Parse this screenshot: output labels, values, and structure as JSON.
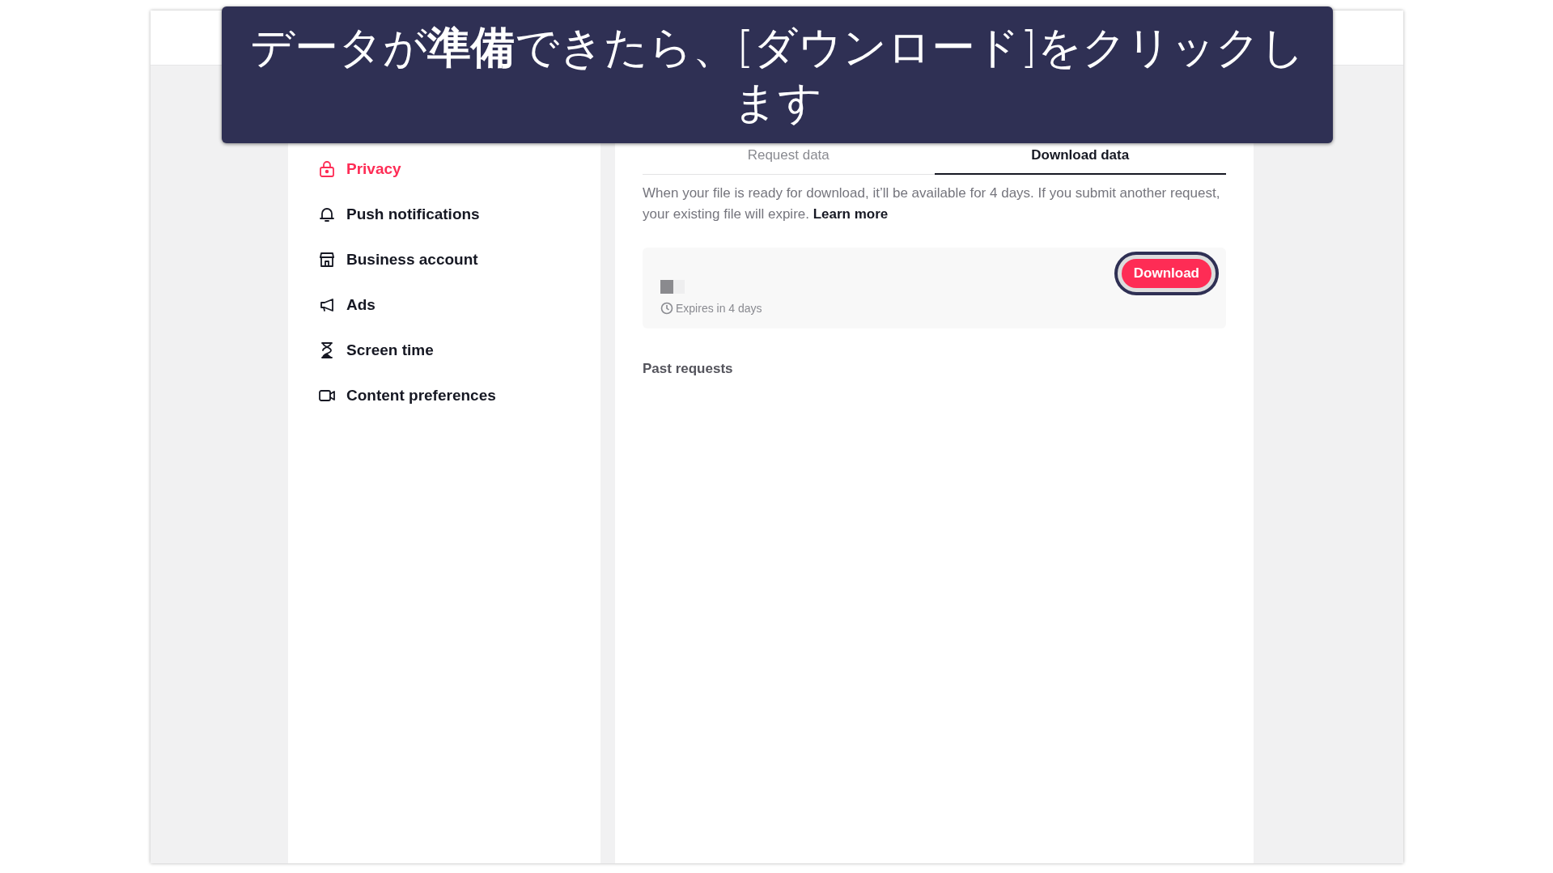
{
  "banner": {
    "text": "データが**準備**できたら、[ダウンロード]をクリックします"
  },
  "sidebar": {
    "items": [
      {
        "label": "Privacy",
        "selected": true
      },
      {
        "label": "Push notifications",
        "selected": false
      },
      {
        "label": "Business account",
        "selected": false
      },
      {
        "label": "Ads",
        "selected": false
      },
      {
        "label": "Screen time",
        "selected": false
      },
      {
        "label": "Content preferences",
        "selected": false
      }
    ]
  },
  "tabs": [
    {
      "label": "Request data",
      "selected": false
    },
    {
      "label": "Download data",
      "selected": true
    }
  ],
  "description": {
    "text": "When your file is ready for download, it’ll be available for 4 days. If you submit another request, your existing file will expire.",
    "link": "Learn more"
  },
  "file_card": {
    "expiry": "Expires in 4 days",
    "button": {
      "label": "Download",
      "focused": true
    }
  },
  "past_requests": {
    "title": "Past requests"
  }
}
